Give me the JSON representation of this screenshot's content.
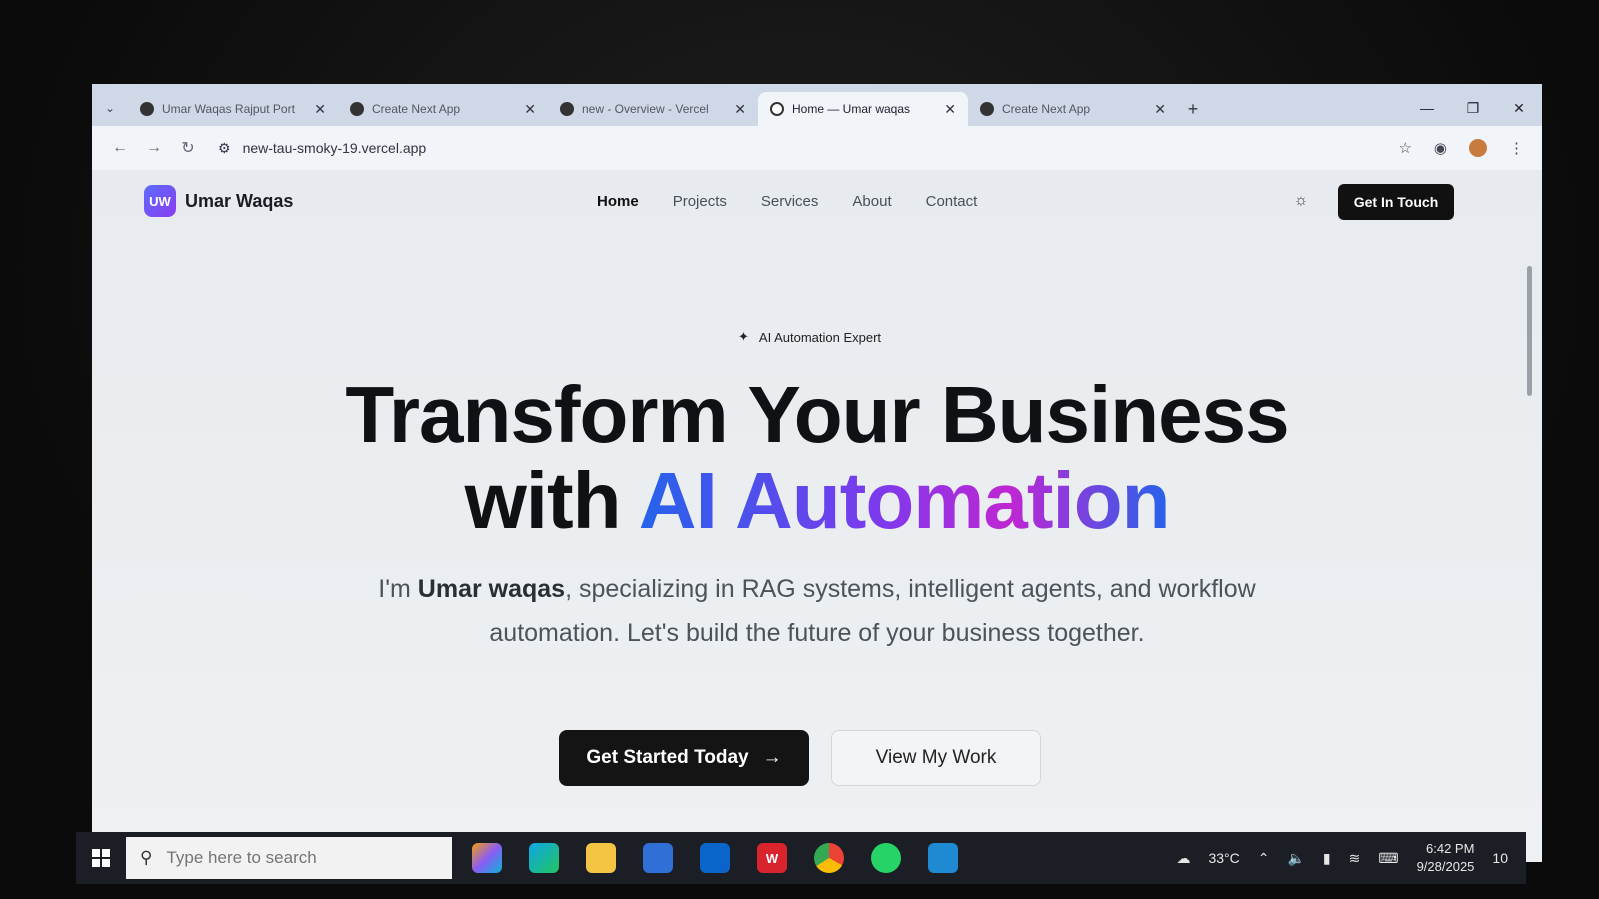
{
  "browser": {
    "tabs": [
      {
        "title": "Umar Waqas Rajput Port",
        "active": false,
        "icon": "vercel-icon"
      },
      {
        "title": "Create Next App",
        "active": false,
        "icon": "vercel-icon"
      },
      {
        "title": "new - Overview - Vercel",
        "active": false,
        "icon": "vercel-icon"
      },
      {
        "title": "Home — Umar waqas",
        "active": true,
        "icon": "globe-icon"
      },
      {
        "title": "Create Next App",
        "active": false,
        "icon": "vercel-icon"
      }
    ],
    "url": "new-tau-smoky-19.vercel.app"
  },
  "site": {
    "logo_badge": "UW",
    "logo_name": "Umar Waqas",
    "nav": [
      "Home",
      "Projects",
      "Services",
      "About",
      "Contact"
    ],
    "cta": "Get In Touch",
    "badge": "AI Automation Expert",
    "headline_line1": "Transform Your Business",
    "headline_with": "with",
    "headline_gradient": "AI Automation",
    "sub_prefix": "I'm",
    "sub_name": "Umar waqas",
    "sub_rest": ", specializing in RAG systems, intelligent agents, and workflow automation. Let's build the future of your business together.",
    "btn_primary": "Get Started Today",
    "btn_secondary": "View My Work"
  },
  "taskbar": {
    "search_placeholder": "Type here to search",
    "temperature": "33°C",
    "time": "6:42 PM",
    "date": "9/28/2025",
    "notification_count": "10"
  },
  "colors": {
    "gradient_start": "#2563eb",
    "gradient_mid": "#7c3aed",
    "gradient_end": "#c026d3"
  }
}
